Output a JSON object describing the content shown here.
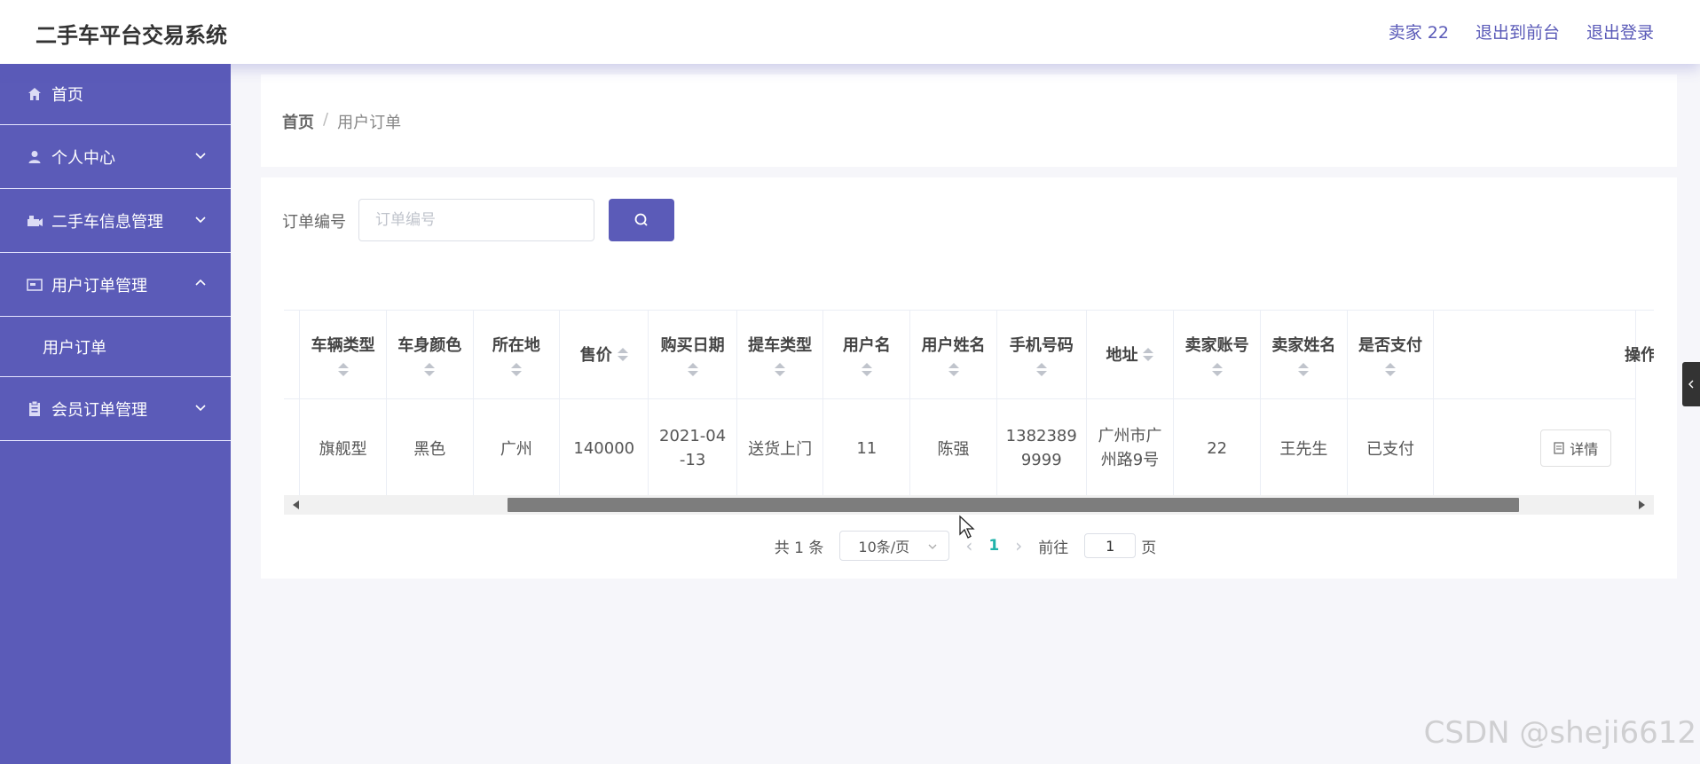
{
  "header": {
    "app_title": "二手车平台交易系统",
    "user": "卖家 22",
    "to_front": "退出到前台",
    "logout": "退出登录"
  },
  "sidebar": {
    "items": [
      {
        "label": "首页",
        "icon": "home-icon"
      },
      {
        "label": "个人中心",
        "icon": "user-icon"
      },
      {
        "label": "二手车信息管理",
        "icon": "car-icon"
      },
      {
        "label": "用户订单管理",
        "icon": "order-icon",
        "expanded": true,
        "children": [
          {
            "label": "用户订单"
          }
        ]
      },
      {
        "label": "会员订单管理",
        "icon": "clipboard-icon"
      }
    ]
  },
  "breadcrumb": {
    "home": "首页",
    "sep": "/",
    "current": "用户订单"
  },
  "search": {
    "label": "订单编号",
    "placeholder": "订单编号",
    "button_icon": "search-icon"
  },
  "table": {
    "columns": [
      "车辆类型",
      "车身颜色",
      "所在地",
      "售价",
      "购买日期",
      "提车类型",
      "用户名",
      "用户姓名",
      "手机号码",
      "地址",
      "卖家账号",
      "卖家姓名",
      "是否支付",
      "操作"
    ],
    "rows": [
      {
        "cells": [
          "旗舰型",
          "黑色",
          "广州",
          "140000",
          "2021-04\n-13",
          "送货上门",
          "11",
          "陈强",
          "1382389\n9999",
          "广州市广\n州路9号",
          "22",
          "王先生",
          "已支付"
        ],
        "action": "详情"
      }
    ]
  },
  "pagination": {
    "total": "共 1 条",
    "page_size": "10条/页",
    "current_page": "1",
    "goto_label": "前往",
    "goto_value": "1",
    "page_suffix": "页"
  },
  "watermark": "CSDN @sheji6612",
  "colors": {
    "primary": "#5b5bb8",
    "active_page": "#20b2aa"
  }
}
